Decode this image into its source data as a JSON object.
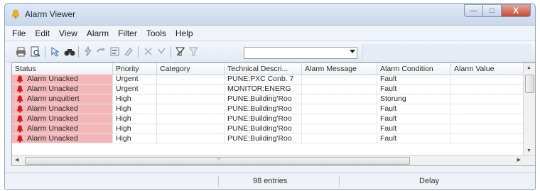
{
  "window": {
    "title": "Alarm Viewer",
    "controls": {
      "minimize": "—",
      "maximize": "□",
      "close": "X"
    }
  },
  "menu": [
    "File",
    "Edit",
    "View",
    "Alarm",
    "Filter",
    "Tools",
    "Help"
  ],
  "toolbar": {
    "icons": [
      "print-icon",
      "print-preview-icon",
      "selection-icon",
      "find-icon",
      "acknowledge-icon",
      "refresh-icon",
      "report-icon",
      "clear-icon",
      "mute-icon",
      "unmute-icon",
      "filter-icon",
      "edit-filter-icon"
    ],
    "filter_value": ""
  },
  "grid": {
    "columns": [
      "Status",
      "Priority",
      "Category",
      "Technical Descri...",
      "Alarm Message",
      "Alarm Condition",
      "Alarm Value"
    ],
    "rows": [
      {
        "status": "Alarm Unacked",
        "priority": "Urgent",
        "category": "",
        "technical": "PUNE:PXC Conb. 7",
        "message": "",
        "condition": "Fault",
        "value": ""
      },
      {
        "status": "Alarm Unacked",
        "priority": "Urgent",
        "category": "",
        "technical": "MONITOR:ENERG",
        "message": "",
        "condition": "Fault",
        "value": ""
      },
      {
        "status": "Alarm unquitiert",
        "priority": "High",
        "category": "",
        "technical": "PUNE:Building'Roo",
        "message": "",
        "condition": "Storung",
        "value": ""
      },
      {
        "status": "Alarm Unacked",
        "priority": "High",
        "category": "",
        "technical": "PUNE:Building'Roo",
        "message": "",
        "condition": "Fault",
        "value": ""
      },
      {
        "status": "Alarm Unacked",
        "priority": "High",
        "category": "",
        "technical": "PUNE:Building'Roo",
        "message": "",
        "condition": "Fault",
        "value": ""
      },
      {
        "status": "Alarm Unacked",
        "priority": "High",
        "category": "",
        "technical": "PUNE:Building'Roo",
        "message": "",
        "condition": "Fault",
        "value": ""
      },
      {
        "status": "Alarm Unacked",
        "priority": "High",
        "category": "",
        "technical": "PUNE:Building'Roo",
        "message": "",
        "condition": "Fault",
        "value": ""
      }
    ],
    "hscroll_grip": "'''"
  },
  "statusbar": {
    "entries": "98 entries",
    "delay": "Delay"
  },
  "colors": {
    "alarm_row": "#f4b7b7",
    "alarm_icon": "#d01b1b",
    "title_bar": "#dfe9f6"
  }
}
